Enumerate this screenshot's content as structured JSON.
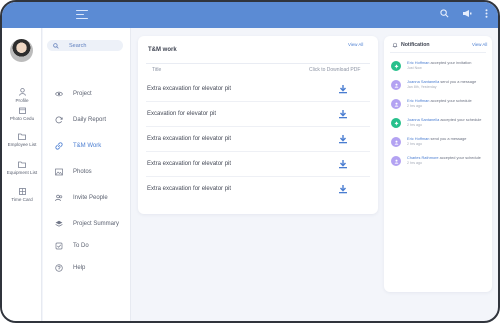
{
  "header": {
    "icons": [
      "menu-icon",
      "search-icon",
      "megaphone-icon",
      "more-vertical-icon"
    ]
  },
  "rail": {
    "items": [
      {
        "label": "Profile",
        "icon": "person-icon"
      },
      {
        "label": "Photo Cedu",
        "icon": "calendar-icon"
      },
      {
        "label": "Employee List",
        "icon": "folder-icon"
      },
      {
        "label": "Equipment List",
        "icon": "folder-icon"
      },
      {
        "label": "Time Card",
        "icon": "timecard-icon"
      }
    ]
  },
  "sidebar": {
    "search_placeholder": "Search",
    "items": [
      {
        "label": "Project",
        "icon": "eye-icon",
        "active": false
      },
      {
        "label": "Daily Report",
        "icon": "refresh-icon",
        "active": false
      },
      {
        "label": "T&M Work",
        "icon": "link-icon",
        "active": true
      },
      {
        "label": "Photos",
        "icon": "image-icon",
        "active": false
      },
      {
        "label": "Invite People",
        "icon": "people-icon",
        "active": false
      },
      {
        "label": "Project Summary",
        "icon": "layers-icon",
        "active": false
      },
      {
        "label": "To Do",
        "icon": "checkbox-icon",
        "active": false
      },
      {
        "label": "Help",
        "icon": "help-icon",
        "active": false
      }
    ]
  },
  "tm_work": {
    "title": "T&M work",
    "view_all": "View All",
    "col_title": "Title",
    "col_download": "Click to Download PDF",
    "rows": [
      {
        "title": "Extra excavation for elevator pit"
      },
      {
        "title": "Excavation for elevator pit"
      },
      {
        "title": "Extra excavation for elevator pit"
      },
      {
        "title": "Extra excavation for elevator pit"
      },
      {
        "title": "Extra excavation for elevator pit"
      }
    ]
  },
  "notifications": {
    "title": "Notification",
    "view_all": "View All",
    "items": [
      {
        "name": "Eric Hoffman",
        "action": "accepted your invitation",
        "time": "Just Now",
        "color": "#27c08c"
      },
      {
        "name": "Joanna Santanella",
        "action": "send you a message",
        "time": "Jan 8th, Yesterday",
        "color": "#b3a2f2"
      },
      {
        "name": "Eric Hoffman",
        "action": "accepted your schedule",
        "time": "2 hrs ago",
        "color": "#b3a2f2"
      },
      {
        "name": "Joanna Santanella",
        "action": "accepted your schedule",
        "time": "2 hrs ago",
        "color": "#27c08c"
      },
      {
        "name": "Eric Hoffman",
        "action": "send you a message",
        "time": "2 hrs ago",
        "color": "#b3a2f2"
      },
      {
        "name": "Charles Rathmore",
        "action": "accepted your schedule",
        "time": "2 hrs ago",
        "color": "#b3a2f2"
      }
    ]
  },
  "colors": {
    "topbar": "#5b8bd4",
    "accent": "#4a7dd1",
    "background": "#f3f5fa"
  }
}
